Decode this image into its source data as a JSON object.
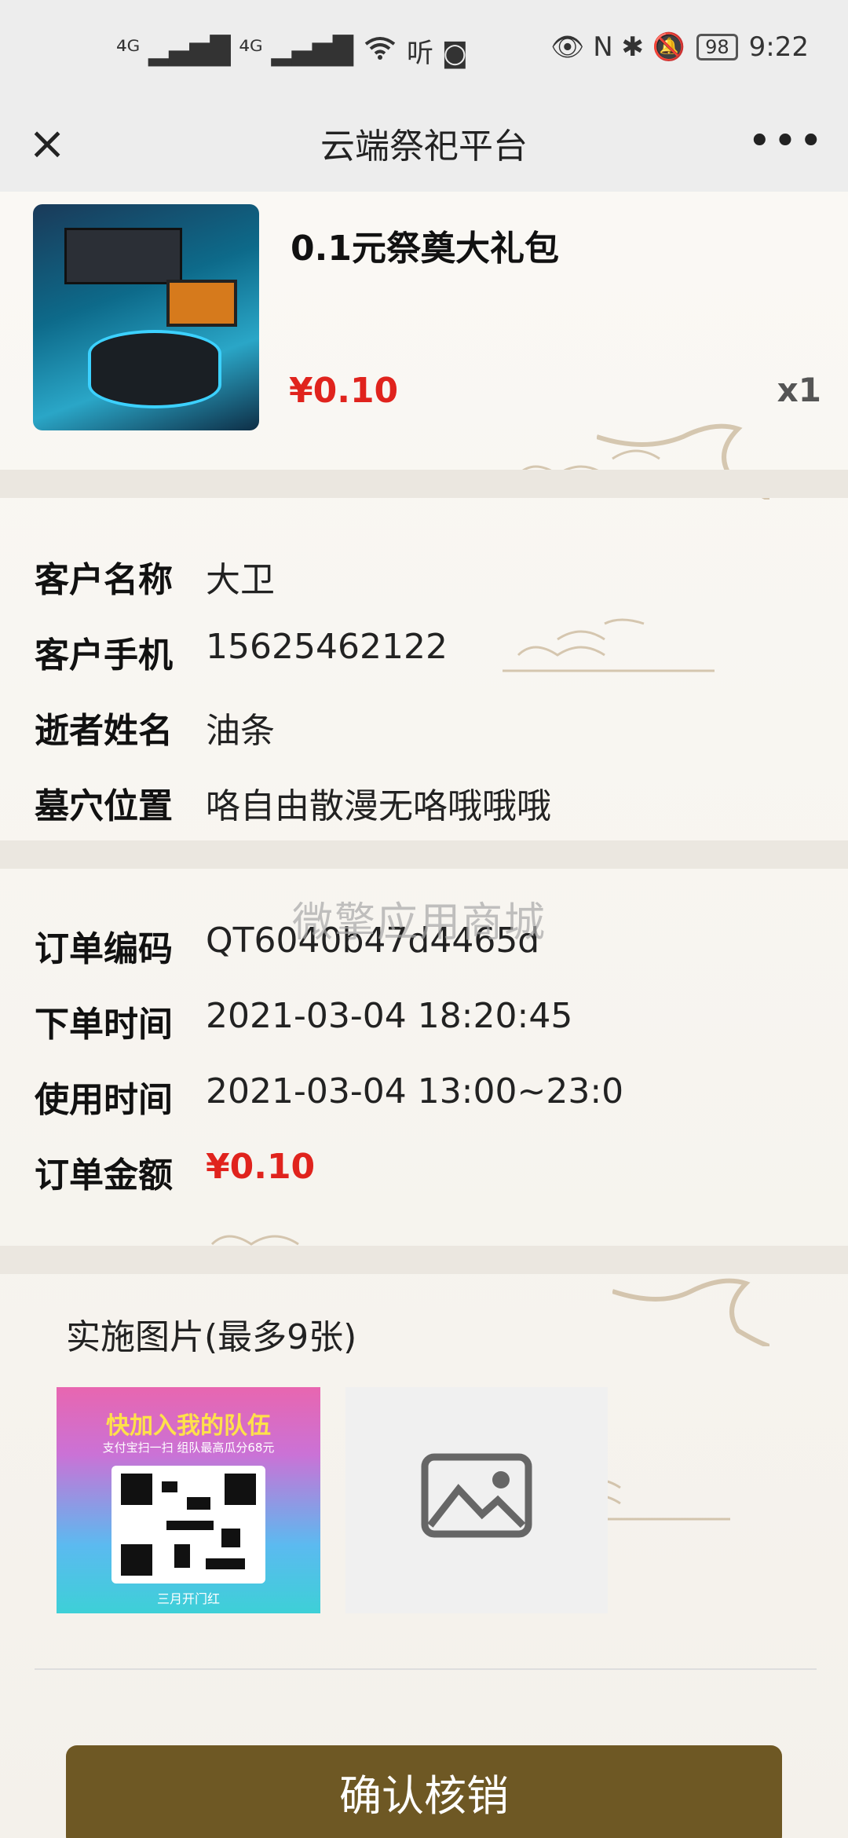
{
  "status_bar": {
    "signal_left": "⁴ᴳ ▂▄▆█ ⁴ᴳ ▂▄▆█",
    "wifi": "WiFi",
    "extra_icons": "听 ◙",
    "right_icons": "👁 N ✱ 🔕",
    "battery": "98",
    "time": "9:22"
  },
  "nav": {
    "title": "云端祭祀平台",
    "close_icon": "×",
    "more_icon": "•••"
  },
  "product": {
    "name": "0.1元祭奠大礼包",
    "price": "¥0.10",
    "quantity": "x1"
  },
  "customer": {
    "name_label": "客户名称",
    "name_value": "大卫",
    "phone_label": "客户手机",
    "phone_value": "15625462122",
    "deceased_label": "逝者姓名",
    "deceased_value": "油条",
    "tomb_label": "墓穴位置",
    "tomb_value": "咯自由散漫无咯哦哦哦"
  },
  "order": {
    "code_label": "订单编码",
    "code_value": "QT6040b47d4465d",
    "order_time_label": "下单时间",
    "order_time_value": "2021-03-04 18:20:45",
    "use_time_label": "使用时间",
    "use_time_value": "2021-03-04 13:00~23:0",
    "amount_label": "订单金额",
    "amount_value": "¥0.10"
  },
  "watermark": "微擎应用商城",
  "photos": {
    "title": "实施图片(最多9张)",
    "thumb_headline": "快加入我的队伍",
    "thumb_sub": "支付宝扫一扫 组队最高瓜分68元",
    "thumb_footer": "三月开门红",
    "add_icon": "image-placeholder-icon"
  },
  "confirm_label": "确认核销",
  "colors": {
    "accent_red": "#e0231d",
    "button_brown": "#6e5824"
  }
}
